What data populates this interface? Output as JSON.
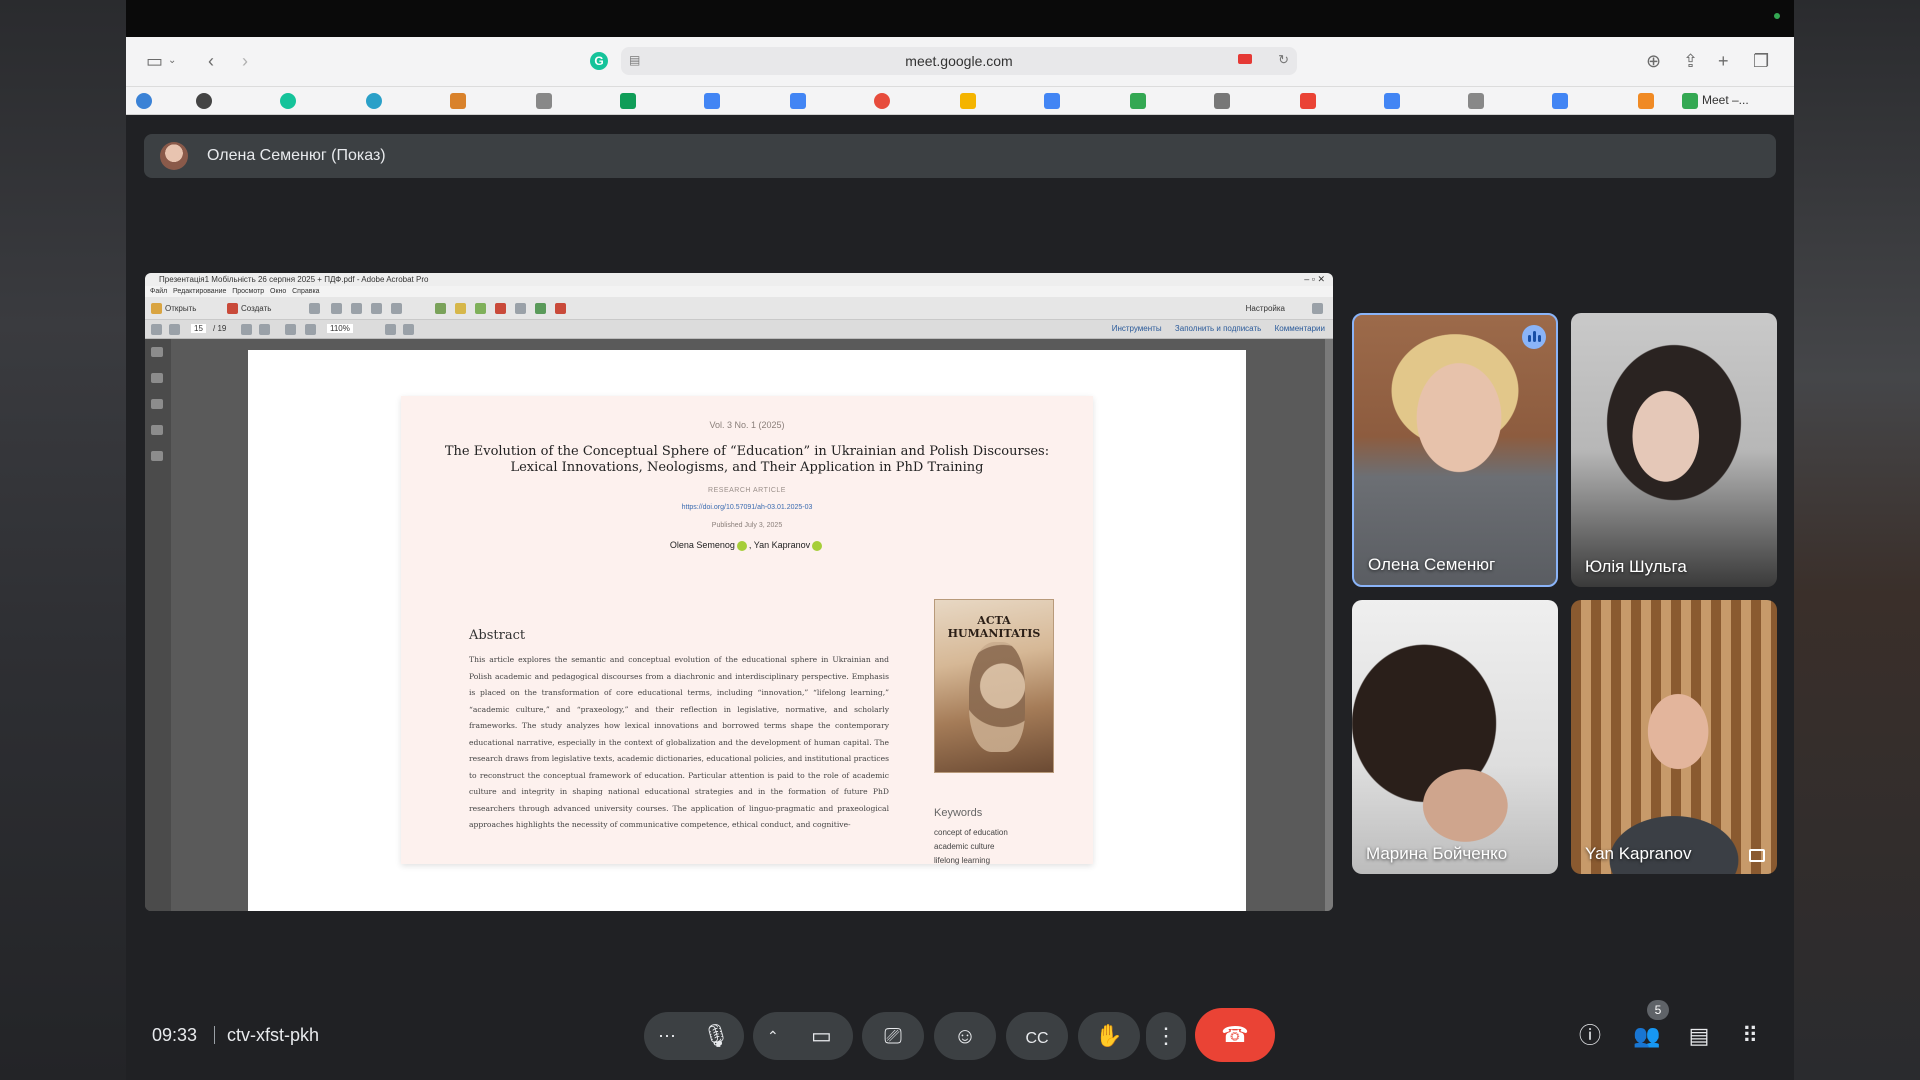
{
  "browser": {
    "url": "meet.google.com",
    "bookmark_last_label": "Meet –..."
  },
  "meet": {
    "presenter_label": "Олена Семенюг (Показ)",
    "time": "09:33",
    "meeting_code": "ctv-xfst-pkh",
    "participant_count": "5",
    "participants": [
      {
        "name": "Олена Семенюг",
        "speaking": true
      },
      {
        "name": "Юлія Шульга"
      },
      {
        "name": "Марина Бойченко"
      },
      {
        "name": "Yan Kapranov"
      }
    ]
  },
  "acrobat": {
    "window_title": "Презентація1 Мобільність 26 серпня 2025 + ПДФ.pdf - Adobe Acrobat Pro",
    "menu": "Файл   Редактирование   Просмотр   Окно   Справка",
    "open_label": "Открыть",
    "create_label": "Создать",
    "settings_label": "Настройка",
    "page_current": "15",
    "page_total": "/ 19",
    "zoom": "110%",
    "nav_links": "Инструменты      Заполнить и подписать      Комментарии"
  },
  "paper": {
    "volume": "Vol. 3 No. 1 (2025)",
    "title": "The Evolution of the Conceptual Sphere of “Education” in Ukrainian and Polish Discourses: Lexical Innovations, Neologisms, and Their Application in PhD Training",
    "type": "RESEARCH ARTICLE",
    "doi": "https://doi.org/10.57091/ah-03.01.2025-03",
    "published": "Published July 3, 2025",
    "author1": "Olena Semenog",
    "author2": "Yan Kapranov",
    "abstract_heading": "Abstract",
    "abstract_text": "This article explores the semantic and conceptual evolution of the educational sphere in Ukrainian and Polish academic and pedagogical discourses from a diachronic and interdisciplinary perspective. Emphasis is placed on the transformation of core educational terms, including “innovation,” “lifelong learning,” “academic culture,” and “praxeology,” and their reflection in legislative, normative, and scholarly frameworks. The study analyzes how lexical innovations and borrowed terms shape the contemporary educational narrative, especially in the context of globalization and the development of human capital. The research draws from legislative texts, academic dictionaries, educational policies, and institutional practices to reconstruct the conceptual framework of education. Particular attention is paid to the role of academic culture and integrity in shaping national educational strategies and in the formation of future PhD researchers through advanced university courses. The application of linguo-pragmatic and praxeological approaches highlights the necessity of communicative competence, ethical conduct, and cognitive-",
    "cover_title": "ACTA HUMANITATIS",
    "keywords_heading": "Keywords",
    "keywords": [
      "concept of education",
      "academic culture",
      "lifelong learning"
    ]
  },
  "colors": {
    "meet_bg": "#202124",
    "control_bg": "#3c4043",
    "end_call": "#ea4335",
    "speaking_border": "#8ab4f8"
  },
  "icons": {
    "sidebar": "sidebar-icon",
    "back": "back-arrow-icon",
    "forward": "forward-arrow-icon",
    "download": "download-icon",
    "share": "share-icon",
    "new_tab": "plus-icon",
    "tabs": "tabs-overview-icon",
    "more": "more-options-icon",
    "mic": "microphone-icon",
    "camera": "camera-icon",
    "present": "present-screen-icon",
    "emoji": "emoji-icon",
    "captions": "captions-icon",
    "hand": "raise-hand-icon",
    "end": "end-call-icon",
    "info": "info-icon",
    "people": "people-icon",
    "chat": "chat-icon",
    "activities": "apps-grid-icon"
  }
}
